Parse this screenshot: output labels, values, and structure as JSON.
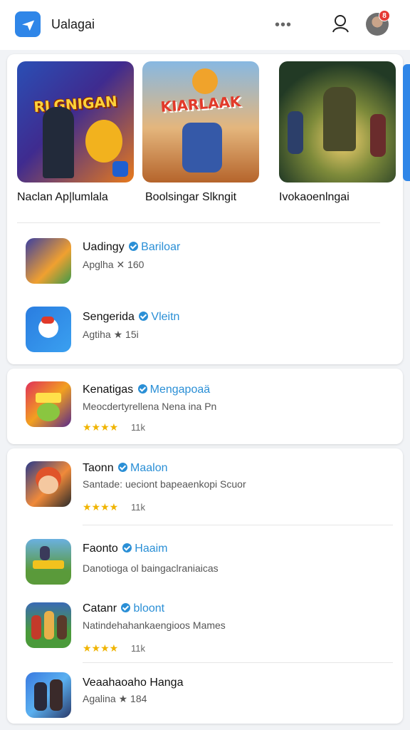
{
  "header": {
    "title": "Ualagai",
    "notification_count": "8",
    "icons": {
      "logo": "plane-icon",
      "more": "more-dots-icon",
      "profile": "profile-icon",
      "avatar": "avatar"
    }
  },
  "featured": [
    {
      "title": "Naclan Ap|lumlala",
      "banner": "RLGNIGAN",
      "colors": [
        "#1b3a8a",
        "#e65b1c"
      ]
    },
    {
      "title": "Boolsingar Slkngit",
      "banner": "KIARLAAK",
      "colors": [
        "#6fa7d8",
        "#c9692c"
      ]
    },
    {
      "title": "Ivokaoenlngai",
      "banner": "",
      "colors": [
        "#2f5a2a",
        "#e0a63a"
      ]
    }
  ],
  "lists": [
    {
      "items": [
        {
          "name": "Uadingy",
          "tag": "Bariloar",
          "meta": "Apglha ✕ 160",
          "rating": "",
          "count": ""
        },
        {
          "name": "Sengerida",
          "tag": "Vleitn",
          "meta": "Agtiha ★ 15i",
          "rating": "",
          "count": ""
        }
      ]
    },
    {
      "items": [
        {
          "name": "Kenatigas",
          "tag": "Mengapoaä",
          "meta": "Meocdertyrellena Nena ina Pn",
          "rating": "★★★★",
          "count": "11k"
        }
      ]
    },
    {
      "items": [
        {
          "name": "Taonn",
          "tag": "Maalon",
          "meta": "Santade: ueciont bapeaenkopi Scuor",
          "rating": "★★★★",
          "count": "11k"
        },
        {
          "name": "Faonto",
          "tag": "Haaim",
          "meta": "Danotioga ol baingaclraniaicas",
          "rating": "",
          "count": ""
        },
        {
          "name": "Catanr",
          "tag": "bloont",
          "meta": "Natindehahankaengioos Mames",
          "rating": "★★★★",
          "count": "11k"
        },
        {
          "name": "Veaahaoaho Hanga",
          "tag": "",
          "meta": "Agalina ★ 184",
          "rating": "",
          "count": ""
        }
      ]
    }
  ],
  "colors": {
    "accent": "#2f86e8",
    "link": "#2a8fd6",
    "star": "#f0b400",
    "badge": "#e53935"
  }
}
